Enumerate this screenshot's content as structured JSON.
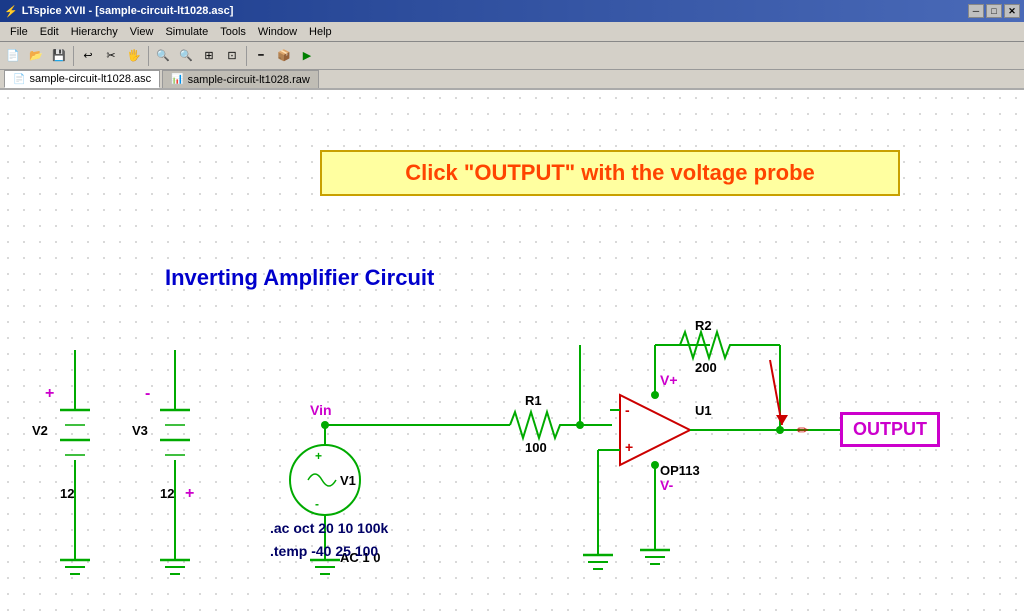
{
  "window": {
    "title": "LTspice XVII - [sample-circuit-lt1028.asc]",
    "icon": "⚡"
  },
  "menu": {
    "items": [
      "File",
      "Edit",
      "Hierarchy",
      "View",
      "Simulate",
      "Tools",
      "Window",
      "Help"
    ]
  },
  "tabs": [
    {
      "label": "sample-circuit-lt1028.asc",
      "active": true,
      "icon": "📄"
    },
    {
      "label": "sample-circuit-lt1028.raw",
      "active": false,
      "icon": "📊"
    }
  ],
  "callout": {
    "text": "Click \"OUTPUT\" with the voltage probe"
  },
  "circuit": {
    "title": "Inverting Amplifier Circuit"
  },
  "components": {
    "R1": {
      "label": "R1",
      "value": "100"
    },
    "R2": {
      "label": "R2",
      "value": "200"
    },
    "V1": {
      "label": "V1"
    },
    "V2": {
      "label": "V2",
      "value": "12"
    },
    "V3": {
      "label": "V3",
      "value": "12"
    },
    "U1": {
      "label": "U1",
      "type": "OP113"
    },
    "Vin": {
      "label": "Vin"
    }
  },
  "output_label": "OUTPUT",
  "spice_commands": [
    "AC 1 0",
    ".ac oct 20 10 100k",
    ".temp -40 25 100"
  ],
  "title_controls": {
    "minimize": "─",
    "maximize": "□",
    "close": "✕"
  }
}
